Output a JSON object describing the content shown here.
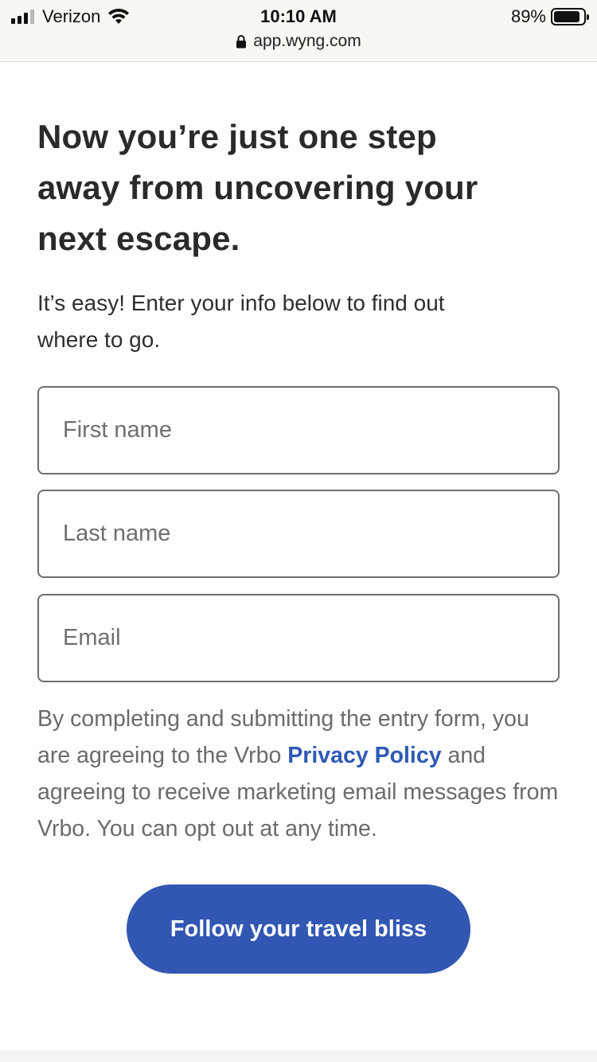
{
  "status_bar": {
    "carrier": "Verizon",
    "time": "10:10 AM",
    "battery": "89%",
    "battery_level": 0.89,
    "signal_bars_filled": 3,
    "signal_bars_total": 4,
    "url": "app.wyng.com"
  },
  "page": {
    "headline": "Now you’re just one step away from uncovering your next escape.",
    "subhead": "It’s easy! Enter your info below to find out where to go."
  },
  "form": {
    "first_name_placeholder": "First name",
    "last_name_placeholder": "Last name",
    "email_placeholder": "Email",
    "first_name_value": "",
    "last_name_value": "",
    "email_value": ""
  },
  "legal": {
    "before_link": "By completing and submitting the entry form, you are agreeing to the Vrbo ",
    "link_text": "Privacy Policy",
    "after_link": " and agreeing to receive marketing email messages from Vrbo. You can opt out at any time."
  },
  "cta": {
    "label": "Follow your travel bliss"
  },
  "colors": {
    "accent": "#3257b3",
    "link": "#2f5ab6",
    "text": "#2a2a2a",
    "muted": "#6b6b6b"
  },
  "icons": [
    "signal-icon",
    "wifi-icon",
    "battery-icon",
    "lock-icon"
  ]
}
